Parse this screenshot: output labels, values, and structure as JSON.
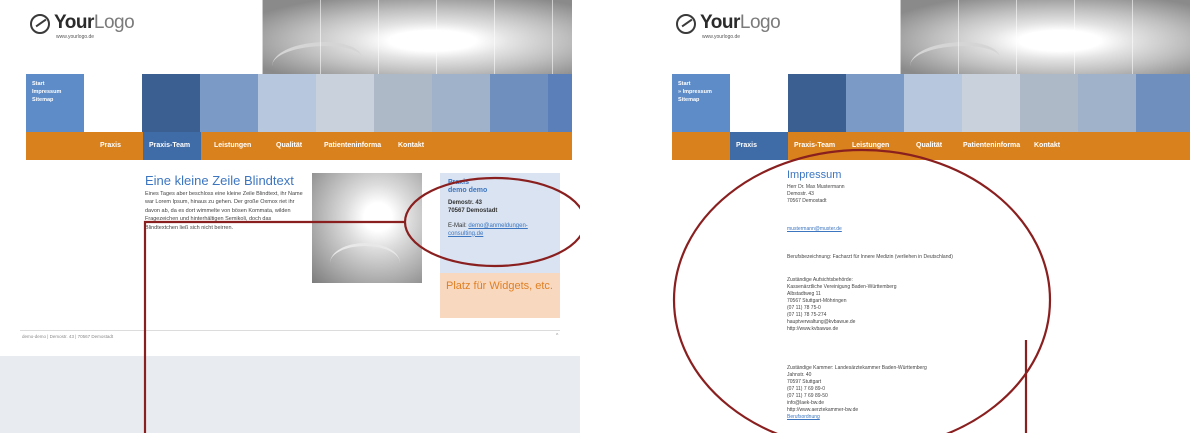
{
  "left": {
    "logo": {
      "main_bold": "Your",
      "main_light": "Logo",
      "sub": "www.yourlogo.de"
    },
    "side_nav": [
      "Start",
      "Impressum",
      "Sitemap"
    ],
    "nav": [
      "Praxis",
      "Praxis-Team",
      "Leistungen",
      "Qualität",
      "Patienteninforma",
      "Kontakt"
    ],
    "content": {
      "title": "Eine kleine Zeile Blindtext",
      "body": "Eines Tages aber beschloss eine kleine Zeile Blindtext, ihr Name war Lorem Ipsum, hinaus zu gehen. Der große Oxmox riet ihr davon ab, da es dort wimmelte von bösen Kommata, wilden Fragezeichen und hinterhältigen Semikoli, doch das Blindtextchen ließ sich nicht beirren."
    },
    "info": {
      "line1": "Praxis",
      "line2": "demo demo",
      "street": "Demostr. 43",
      "city": "70567 Demostadt",
      "email_label": "E-Mail:",
      "email": "demo@anmeldungen-consulting.de"
    },
    "widget": "Platz für Widgets, etc.",
    "footer": "demo-demo | Demostr. 43 | 70567 Demostadt",
    "footer_mark": "^"
  },
  "right": {
    "logo": {
      "main_bold": "Your",
      "main_light": "Logo",
      "sub": "www.yourlogo.de"
    },
    "side_nav": [
      "Start",
      "» Impressum",
      "Sitemap"
    ],
    "nav": [
      "Praxis",
      "Praxis-Team",
      "Leistungen",
      "Qualität",
      "Patienteninforma",
      "Kontakt"
    ],
    "impressum": {
      "title": "Impressum",
      "name": "Herr Dr. Max Mustermann",
      "street": "Demostr. 43",
      "city": "70567 Demostadt",
      "email": "mustermann@muster.de",
      "job": "Berufsbezeichnung: Facharzt für Innere Medizin (verliehen in Deutschland)",
      "authority": [
        "Zuständige Aufsichtsbehörde:",
        "Kassenärztliche Vereinigung Baden-Württemberg",
        "Albstadtweg 11",
        "70567 Stuttgart-Möhringen",
        "(07 11) 78 75-0",
        "(07 11) 78 75-274",
        "hauptverwaltung@kvbawue.de",
        "http://www.kvbawue.de"
      ],
      "chamber": [
        "Zuständige Kammer: Landesärztekammer Baden-Württemberg",
        "Jahnstr. 40",
        "70597 Stuttgart",
        "(07 11) 7 69 89-0",
        "(07 11) 7 69 89-50",
        "info@laek-bw.de",
        "http://www.aerztekammer-bw.de"
      ],
      "last_link": "Berufsordnung"
    }
  }
}
